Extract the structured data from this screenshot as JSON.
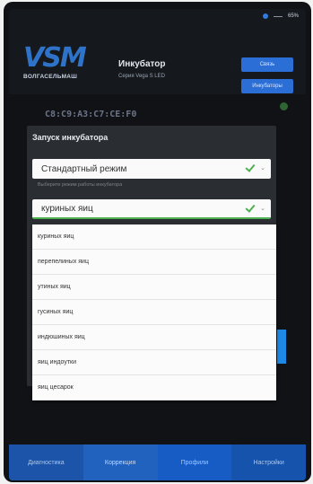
{
  "status": {
    "battery": "65%"
  },
  "header": {
    "logo_mark": "VSM",
    "logo_sub": "ВОЛГАСЕЛЬМАШ",
    "device_name": "Инкубатор",
    "device_series": "Серия Vega S LED",
    "connect_label": "Связь",
    "incubators_label": "Инкубаторы"
  },
  "mac": {
    "address": "C8:C9:A3:C7:CE:F0"
  },
  "dialog": {
    "title": "Запуск инкубатора",
    "mode_value": "Стандартный режим",
    "mode_hint": "Выберите режим работы инкубатора",
    "egg_value": "куриных яиц"
  },
  "egg_options": [
    "куриных яиц",
    "перепелиных яиц",
    "утиных яиц",
    "гусиных яиц",
    "индюшиных яиц",
    "яиц индоутки",
    "яиц цесарок"
  ],
  "nav": {
    "tabs": [
      "Диагностика",
      "Коррекция",
      "Профили",
      "Настройки"
    ]
  },
  "colors": {
    "accent": "#2b6fd6",
    "nav": "#1a5db8",
    "check": "#4caf50"
  }
}
